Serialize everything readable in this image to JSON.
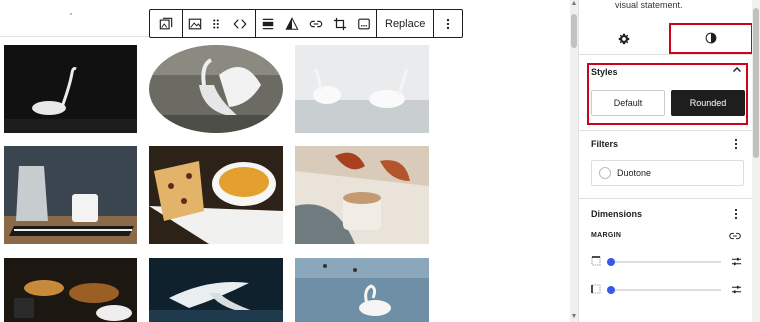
{
  "toolbar": {
    "replace_label": "Replace",
    "icons": [
      "gallery-icon",
      "image-icon",
      "drag-handle-icon",
      "move-arrows-icon",
      "align-icon",
      "duotone-filter-icon",
      "link-icon",
      "crop-icon",
      "text-overlay-icon",
      "more-options-icon"
    ]
  },
  "sidebar": {
    "description": "visual statement.",
    "tabs": [
      "settings",
      "styles"
    ],
    "styles": {
      "title": "Styles",
      "options": [
        {
          "label": "Default",
          "selected": false
        },
        {
          "label": "Rounded",
          "selected": true
        }
      ]
    },
    "filters": {
      "title": "Filters",
      "duotone_label": "Duotone"
    },
    "dimensions": {
      "title": "Dimensions",
      "margin_label": "MARGIN",
      "sliders": [
        {
          "side": "top",
          "value_fraction": 0.0
        },
        {
          "side": "bottom",
          "value_fraction": 0.0
        }
      ]
    }
  },
  "gallery": {
    "images": [
      "swan-on-dark-water",
      "swan-spreading-wings",
      "two-swans-on-ice",
      "coffee-pot-and-mug",
      "cake-and-tea",
      "coffee-with-autumn-leaves",
      "breakfast-table",
      "swan-landing",
      "swans-on-water"
    ]
  },
  "colors": {
    "accent": "#3858e9",
    "highlight": "#d0021b",
    "dark": "#1e1e1e"
  }
}
